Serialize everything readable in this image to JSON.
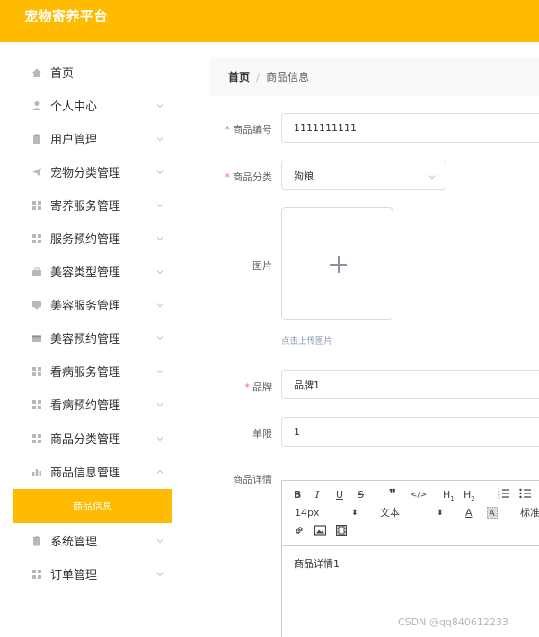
{
  "header": {
    "title": "宠物寄养平台"
  },
  "sidebar": {
    "items": [
      {
        "label": "首页",
        "icon": "home-icon",
        "has_chevron": false
      },
      {
        "label": "个人中心",
        "icon": "user-icon",
        "has_chevron": true
      },
      {
        "label": "用户管理",
        "icon": "clipboard-icon",
        "has_chevron": true
      },
      {
        "label": "宠物分类管理",
        "icon": "send-icon",
        "has_chevron": true
      },
      {
        "label": "寄养服务管理",
        "icon": "grid-icon",
        "has_chevron": true
      },
      {
        "label": "服务预约管理",
        "icon": "grid-icon",
        "has_chevron": true
      },
      {
        "label": "美容类型管理",
        "icon": "briefcase-icon",
        "has_chevron": true
      },
      {
        "label": "美容服务管理",
        "icon": "message-icon",
        "has_chevron": true
      },
      {
        "label": "美容预约管理",
        "icon": "card-icon",
        "has_chevron": true
      },
      {
        "label": "看病服务管理",
        "icon": "grid-icon",
        "has_chevron": true
      },
      {
        "label": "看病预约管理",
        "icon": "grid-icon",
        "has_chevron": true
      },
      {
        "label": "商品分类管理",
        "icon": "grid-icon",
        "has_chevron": true
      },
      {
        "label": "商品信息管理",
        "icon": "chart-icon",
        "has_chevron": true
      },
      {
        "label": "系统管理",
        "icon": "clipboard-icon",
        "has_chevron": true
      },
      {
        "label": "订单管理",
        "icon": "grid-icon",
        "has_chevron": true
      }
    ],
    "active_submenu": "商品信息"
  },
  "breadcrumb": {
    "home": "首页",
    "separator": "/",
    "current": "商品信息"
  },
  "form": {
    "product_code": {
      "label": "商品编号",
      "required": true,
      "value": "1111111111"
    },
    "category": {
      "label": "商品分类",
      "required": true,
      "value": "狗粮"
    },
    "image": {
      "label": "图片",
      "tip": "点击上传图片"
    },
    "brand": {
      "label": "品牌",
      "required": true,
      "value": "品牌1"
    },
    "limit": {
      "label": "单限",
      "value": "1"
    },
    "details": {
      "label": "商品详情",
      "content": "商品详情1"
    }
  },
  "editor_toolbar": {
    "font_size": "14px",
    "font_family": "文本",
    "header_style": "标准",
    "buttons": [
      "bold",
      "italic",
      "underline",
      "strike",
      "blockquote",
      "code-block",
      "header-1",
      "header-2",
      "ordered-list",
      "bullet-list",
      "font-color",
      "background-color",
      "link",
      "image",
      "video"
    ]
  },
  "watermark": "CSDN @qq840612233",
  "colors": {
    "accent": "#ffbb00",
    "required": "#f56c6c"
  }
}
